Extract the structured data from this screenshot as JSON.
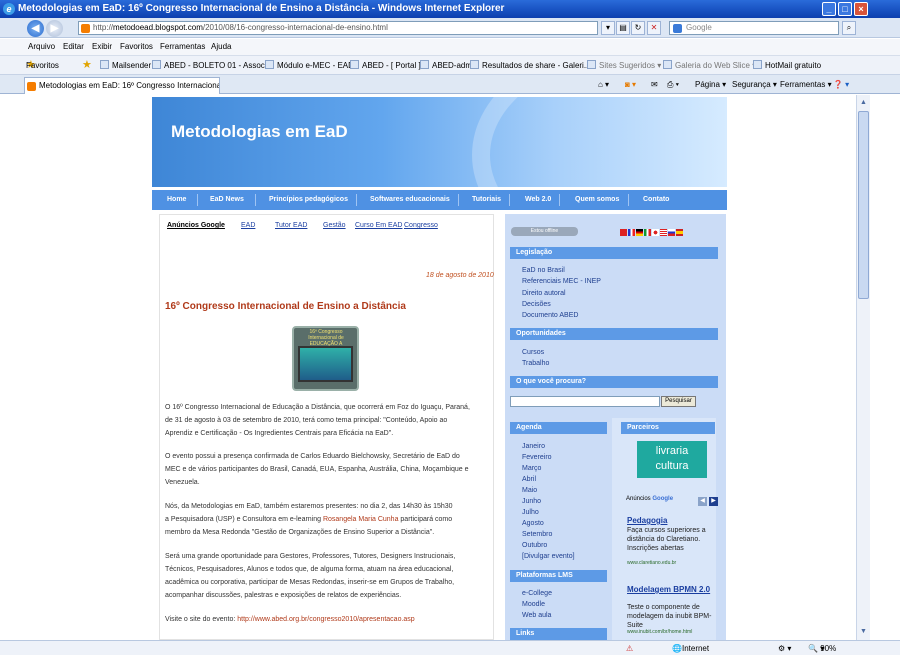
{
  "window": {
    "title": "Metodologias em EaD: 16º Congresso Internacional de Ensino a Distância - Windows Internet Explorer",
    "min": "_",
    "max": "□",
    "close": "×"
  },
  "address": {
    "url_prefix": "http://",
    "url_domain": "metodoead.blogspot.com",
    "url_path": "/2010/08/16-congresso-internacional-de-ensino.html",
    "search_placeholder": "Google"
  },
  "menu": [
    "Arquivo",
    "Editar",
    "Exibir",
    "Favoritos",
    "Ferramentas",
    "Ajuda"
  ],
  "favorites": {
    "label": "Favoritos",
    "items": [
      "Mailsender",
      "ABED - BOLETO 01 - Associ...",
      "Módulo e-MEC - EAD",
      "ABED - [ Portal ]",
      "ABED-adm",
      "Resultados de share - Galeri...",
      "Sites Sugeridos ▾",
      "Galeria do Web Slice ▾",
      "HotMail gratuito"
    ]
  },
  "tab": {
    "title": "Metodologias em EaD: 16º Congresso Internacional d...",
    "tools": [
      "Página ▾",
      "Segurança ▾",
      "Ferramentas ▾"
    ]
  },
  "blog": {
    "title": "Metodologias em EaD",
    "nav": [
      "Home",
      "EaD News",
      "Princípios pedagógicos",
      "Softwares educacionais",
      "Tutoriais",
      "Web 2.0",
      "Quem somos",
      "Contato"
    ],
    "ads": {
      "label": "Anúncios Google",
      "links": [
        "EAD",
        "Tutor EAD",
        "Gestão",
        "Curso Em EAD",
        "Congresso"
      ]
    },
    "post": {
      "date": "18 de agosto de 2010",
      "title": "16º Congresso Internacional de Ensino a Distância",
      "logo_text": "16º Congresso Internacional de EDUCAÇÃO A DISTÂNCIA",
      "lines": [
        "O 16º Congresso Internacional de Educação a Distância, que ocorrerá em Foz do Iguaçu, Paraná,",
        "de 31 de agosto à 03 de setembro de 2010, terá como tema principal: \"Conteúdo, Apoio ao",
        "Aprendiz e Certificação - Os Ingredientes Centrais para Eficácia na EaD\".",
        "O evento possui a presença confirmada de Carlos Eduardo Bielchowsky, Secretário de EaD do",
        "MEC e de vários participantes do Brasil, Canadá, EUA, Espanha, Austrália, China, Moçambique e",
        "Venezuela.",
        "Nós, da Metodologias em EaD, também estaremos presentes: no dia 2, das 14h30 às 15h30",
        "membro da Mesa Redonda \"Gestão de Organizações de Ensino Superior a Distância\".",
        "Será uma grande oportunidade para Gestores, Professores, Tutores, Designers Instrucionais,",
        "Técnicos, Pesquisadores, Alunos e todos que, de alguma forma, atuam na área educacional,",
        "acadêmica ou corporativa, participar de Mesas Redondas, inserir-se em Grupos de Trabalho,",
        "acompanhar discussões, palestras e exposições de relatos de experiências."
      ],
      "line_pre": "a Pesquisadora (USP) e Consultora em e-learning ",
      "line_name": "Rosangela Maria Cunha",
      "line_post": " participará como",
      "visit_label": "Visite o site do evento: ",
      "visit_url": "http://www.abed.org.br/congresso2010/apresentacao.asp"
    },
    "sidebar": {
      "offline": "Estou offline",
      "legislacao": {
        "title": "Legislação",
        "items": [
          "EaD no Brasil",
          "Referenciais MEC - INEP",
          "Direito autoral",
          "Decisões",
          "Documento ABED"
        ]
      },
      "oportunidades": {
        "title": "Oportunidades",
        "items": [
          "Cursos",
          "Trabalho"
        ]
      },
      "search": {
        "title": "O que você procura?",
        "button": "Pesquisar"
      },
      "agenda": {
        "title": "Agenda",
        "items": [
          "Janeiro",
          "Fevereiro",
          "Março",
          "Abril",
          "Maio",
          "Junho",
          "Julho",
          "Agosto",
          "Setembro",
          "Outubro",
          "[Divulgar evento]"
        ]
      },
      "plataformas": {
        "title": "Plataformas LMS",
        "items": [
          "e-College",
          "Moodle",
          "Web aula"
        ]
      },
      "links": {
        "title": "Links"
      },
      "parceiros": {
        "title": "Parceiros",
        "logo_line1": "livraria",
        "logo_line2": "cultura"
      },
      "gads": {
        "label": "Anúncios ",
        "brand": "Google"
      },
      "ad1": {
        "title": "Pedagogia",
        "desc": "Faça cursos superiores a distância do Claretiano. Inscrições abertas",
        "url": "www.claretiano.edu.br"
      },
      "ad2": {
        "title": "Modelagem BPMN 2.0",
        "desc": "Teste o componente de modelagem da inubit BPM-Suite",
        "url": "www.inubit.com/br/home.html"
      }
    }
  },
  "status": {
    "zone": "Internet",
    "zoom": "90%"
  }
}
